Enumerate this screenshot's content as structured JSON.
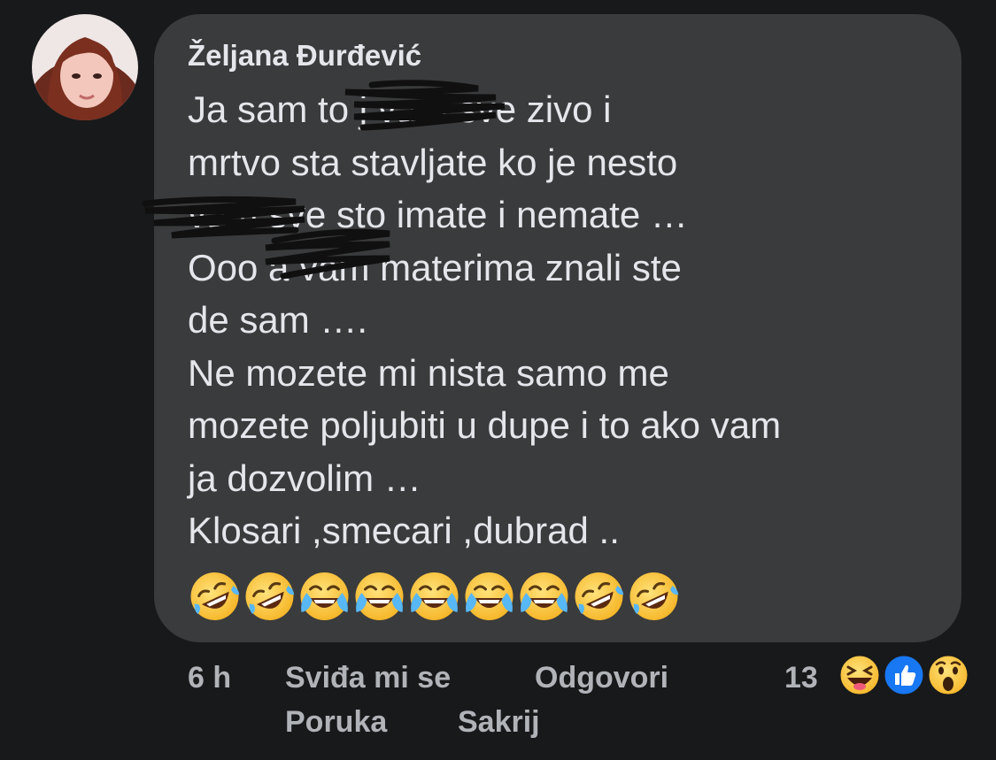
{
  "comment": {
    "author": "Željana Đurđević",
    "lines": [
      "Ja sam to j         vam sve zivo i",
      "mrtvo sta stavljate ko je nesto",
      "           vam sve sto imate i nemate …",
      "Ooo        a vam materima znali ste",
      "de sam ….",
      "Ne mozete mi nista samo me",
      "mozete poljubiti u dupe i to ako vam",
      "ja dozvolim …",
      "Klosari ,smecari ,dubrad .."
    ],
    "emojis": [
      "rofl-emoji",
      "rofl-emoji",
      "tears-of-joy-emoji",
      "tears-of-joy-emoji",
      "tears-of-joy-emoji",
      "tears-of-joy-emoji",
      "tears-of-joy-emoji",
      "rofl-emoji",
      "rofl-emoji"
    ]
  },
  "actions": {
    "time": "6 h",
    "like": "Sviđa mi se",
    "reply": "Odgovori",
    "message": "Poruka",
    "hide": "Sakrij"
  },
  "reactions": {
    "count": "13",
    "icons": [
      "haha-reaction-icon",
      "like-reaction-icon",
      "wow-reaction-icon"
    ]
  },
  "colors": {
    "background": "#18191a",
    "bubble": "#3a3b3c",
    "text": "#e4e6eb",
    "meta": "#b0b3b8",
    "like_blue": "#1877f2",
    "emoji_yellow": "#f7c844"
  }
}
